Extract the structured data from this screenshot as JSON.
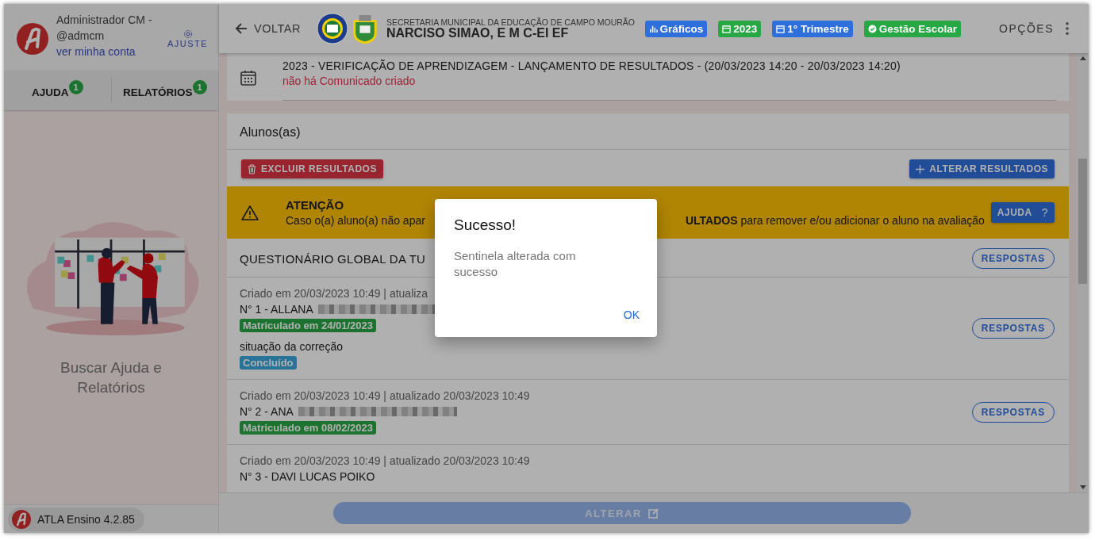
{
  "sidebar": {
    "user_name": "Administrador CM - @admcm",
    "account_link": "ver minha conta",
    "settings_button": "AJUSTE",
    "tabs": [
      {
        "label": "AJUDA",
        "badge": "1"
      },
      {
        "label": "RELATÓRIOS",
        "badge": "1"
      }
    ],
    "empty_state": "Buscar Ajuda e Relatórios",
    "version_badge": "ATLA Ensino 4.2.85"
  },
  "header": {
    "back_button": "VOLTAR",
    "department": "SECRETARIA MUNICIPAL DA EDUCAÇÃO DE CAMPO MOURÃO",
    "school": "NARCISO SIMAO, E M C-EI EF",
    "chips": [
      {
        "label": "Gráficos",
        "color": "#2f6fdc",
        "kind": "chart"
      },
      {
        "label": "2023",
        "color": "#28a745",
        "kind": "calendar"
      },
      {
        "label": "1° Trimestre",
        "color": "#2f6fdc",
        "kind": "calendar"
      },
      {
        "label": "Gestão Escolar",
        "color": "#28a745",
        "kind": "check"
      }
    ],
    "options_button": "OPÇÕES"
  },
  "event": {
    "title": "2023 - VERIFICAÇÃO DE APRENDIZAGEM - LANÇAMENTO DE RESULTADOS - (20/03/2023 14:20 - 20/03/2023 14:20)",
    "notice": "não há Comunicado criado"
  },
  "students_section": {
    "title": "Alunos(as)",
    "delete_button": "EXCLUIR RESULTADOS",
    "edit_button": "ALTERAR RESULTADOS",
    "alert": {
      "title": "ATENÇÃO",
      "text_start": "Caso o(a) aluno(a) não apar",
      "text_end": "**ULTADOS** para remover e/ou adicionar o aluno na avaliação",
      "help_button": "AJUDA",
      "help_mark": "?"
    },
    "questionnaire": {
      "title": "QUESTIONÁRIO GLOBAL DA TU",
      "button": "RESPOSTAS"
    },
    "students": [
      {
        "meta": "Criado em 20/03/2023 10:49 | atualiza",
        "name": "N° 1 - ALLANA",
        "redacted": true,
        "enrollment": "Matriculado em 24/01/2023",
        "status_label": "situação da correção",
        "status": "Concluído",
        "button": "RESPOSTAS"
      },
      {
        "meta": "Criado em 20/03/2023 10:49 | atualizado 20/03/2023 10:49",
        "name": "N° 2 - ANA",
        "redacted": true,
        "enrollment": "Matriculado em 08/02/2023",
        "button": "RESPOSTAS"
      },
      {
        "meta": "Criado em 20/03/2023 10:49 | atualizado 20/03/2023 10:49",
        "name": "N° 3 - DAVI LUCAS POIKO",
        "redacted": false
      }
    ]
  },
  "footer": {
    "save_button": "ALTERAR",
    "disabled": true
  },
  "dialog": {
    "title": "Sucesso!",
    "message": "Sentinela alterada com sucesso",
    "ok_button": "OK"
  }
}
